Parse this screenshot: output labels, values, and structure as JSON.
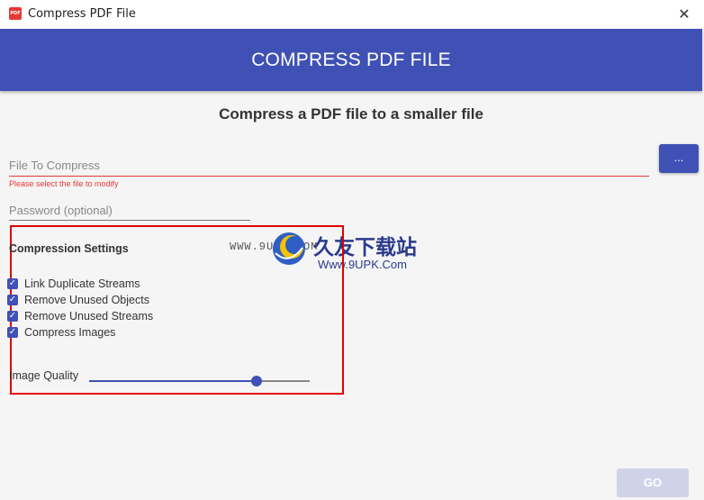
{
  "window": {
    "title": "Compress PDF File",
    "app_icon_text": "PDF",
    "close_glyph": "✕"
  },
  "header": {
    "title": "COMPRESS PDF FILE",
    "color": "#3f51b5"
  },
  "subtitle": "Compress a PDF file to a smaller file",
  "file_field": {
    "placeholder": "File To Compress",
    "value": "",
    "error": "Please select the file to modify"
  },
  "browse_button": {
    "label": "..."
  },
  "password_field": {
    "placeholder": "Password (optional)",
    "value": ""
  },
  "compression": {
    "title": "Compression Settings",
    "options": [
      {
        "label": "Link Duplicate Streams",
        "checked": true
      },
      {
        "label": "Remove Unused Objects",
        "checked": true
      },
      {
        "label": "Remove Unused Streams",
        "checked": true
      },
      {
        "label": "Compress Images",
        "checked": true
      }
    ],
    "image_quality": {
      "label": "Image Quality",
      "value_fraction": 0.76
    }
  },
  "watermark": {
    "left_text": "WWW.9UPK.COM",
    "cn_text": "久友下载站",
    "url_text": "Www.9UPK.Com"
  },
  "go_button": {
    "label": "GO",
    "enabled": false
  }
}
